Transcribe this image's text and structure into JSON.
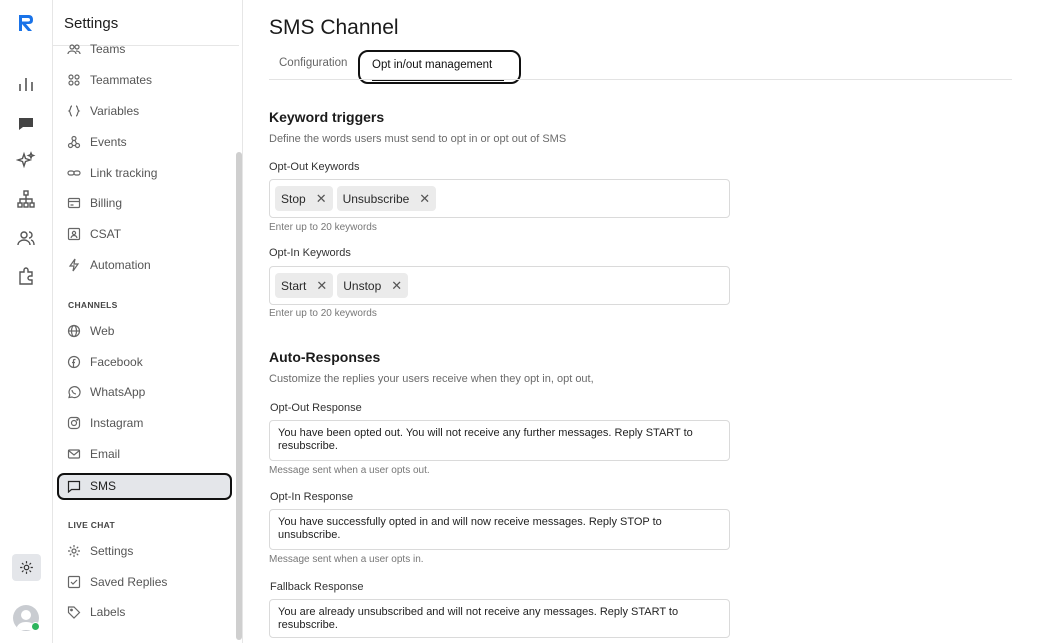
{
  "sidebar": {
    "title": "Settings",
    "items_top": [
      {
        "label": "Teams",
        "icon": "teams-icon"
      },
      {
        "label": "Teammates",
        "icon": "grid-icon"
      },
      {
        "label": "Variables",
        "icon": "braces-icon"
      },
      {
        "label": "Events",
        "icon": "events-icon"
      },
      {
        "label": "Link tracking",
        "icon": "link-icon"
      },
      {
        "label": "Billing",
        "icon": "billing-icon"
      },
      {
        "label": "CSAT",
        "icon": "csat-icon"
      },
      {
        "label": "Automation",
        "icon": "bolt-icon"
      }
    ],
    "channels_heading": "CHANNELS",
    "channels": [
      {
        "label": "Web",
        "icon": "globe-icon"
      },
      {
        "label": "Facebook",
        "icon": "facebook-icon"
      },
      {
        "label": "WhatsApp",
        "icon": "whatsapp-icon"
      },
      {
        "label": "Instagram",
        "icon": "instagram-icon"
      },
      {
        "label": "Email",
        "icon": "mail-icon"
      },
      {
        "label": "SMS",
        "icon": "message-icon"
      }
    ],
    "live_chat_heading": "LIVE CHAT",
    "live_chat": [
      {
        "label": "Settings",
        "icon": "gear-icon"
      },
      {
        "label": "Saved Replies",
        "icon": "saved-replies-icon"
      },
      {
        "label": "Labels",
        "icon": "tag-icon"
      }
    ]
  },
  "main": {
    "title": "SMS Channel",
    "tabs": [
      {
        "label": "Configuration"
      },
      {
        "label": "Opt in/out management"
      }
    ],
    "keyword_triggers": {
      "heading": "Keyword triggers",
      "description": "Define the words users must send to opt in or opt out of SMS",
      "opt_out": {
        "label": "Opt-Out Keywords",
        "tags": [
          "Stop",
          "Unsubscribe"
        ],
        "hint": "Enter up to 20 keywords"
      },
      "opt_in": {
        "label": "Opt-In Keywords",
        "tags": [
          "Start",
          "Unstop"
        ],
        "hint": "Enter up to 20 keywords"
      }
    },
    "auto_responses": {
      "heading": "Auto-Responses",
      "description": "Customize the replies your users receive when they opt in, opt out,",
      "opt_out": {
        "label": "Opt-Out Response",
        "value": "You have been opted out. You will not receive any further messages. Reply START to resubscribe.",
        "hint": "Message sent when a user opts out."
      },
      "opt_in": {
        "label": "Opt-In Response",
        "value": "You have successfully opted in and will now receive messages. Reply STOP to unsubscribe.",
        "hint": "Message sent when a user opts in."
      },
      "fallback": {
        "label": "Fallback Response",
        "value": "You are already unsubscribed and will not receive any messages. Reply START to resubscribe."
      }
    }
  },
  "colors": {
    "brand": "#1a73e8",
    "online": "#2db55d",
    "active_bg": "#e4e6ea"
  }
}
